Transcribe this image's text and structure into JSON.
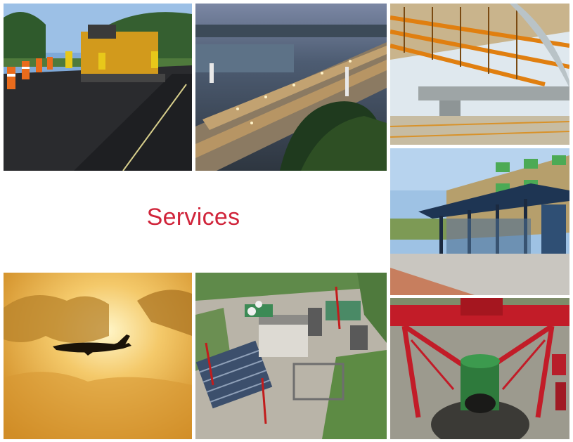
{
  "title": "Services",
  "colors": {
    "title": "#d0243a",
    "background": "#ffffff"
  },
  "photos": [
    {
      "id": "paving",
      "icon": "road-paving-photo"
    },
    {
      "id": "highway",
      "icon": "highway-at-dusk-photo"
    },
    {
      "id": "bridge",
      "icon": "bridge-construction-photo"
    },
    {
      "id": "transit",
      "icon": "bus-shelter-photo"
    },
    {
      "id": "aviation",
      "icon": "airplane-sunset-photo"
    },
    {
      "id": "plant",
      "icon": "industrial-plant-aerial-photo"
    },
    {
      "id": "tunnel",
      "icon": "tunnel-boring-gantry-photo"
    }
  ]
}
